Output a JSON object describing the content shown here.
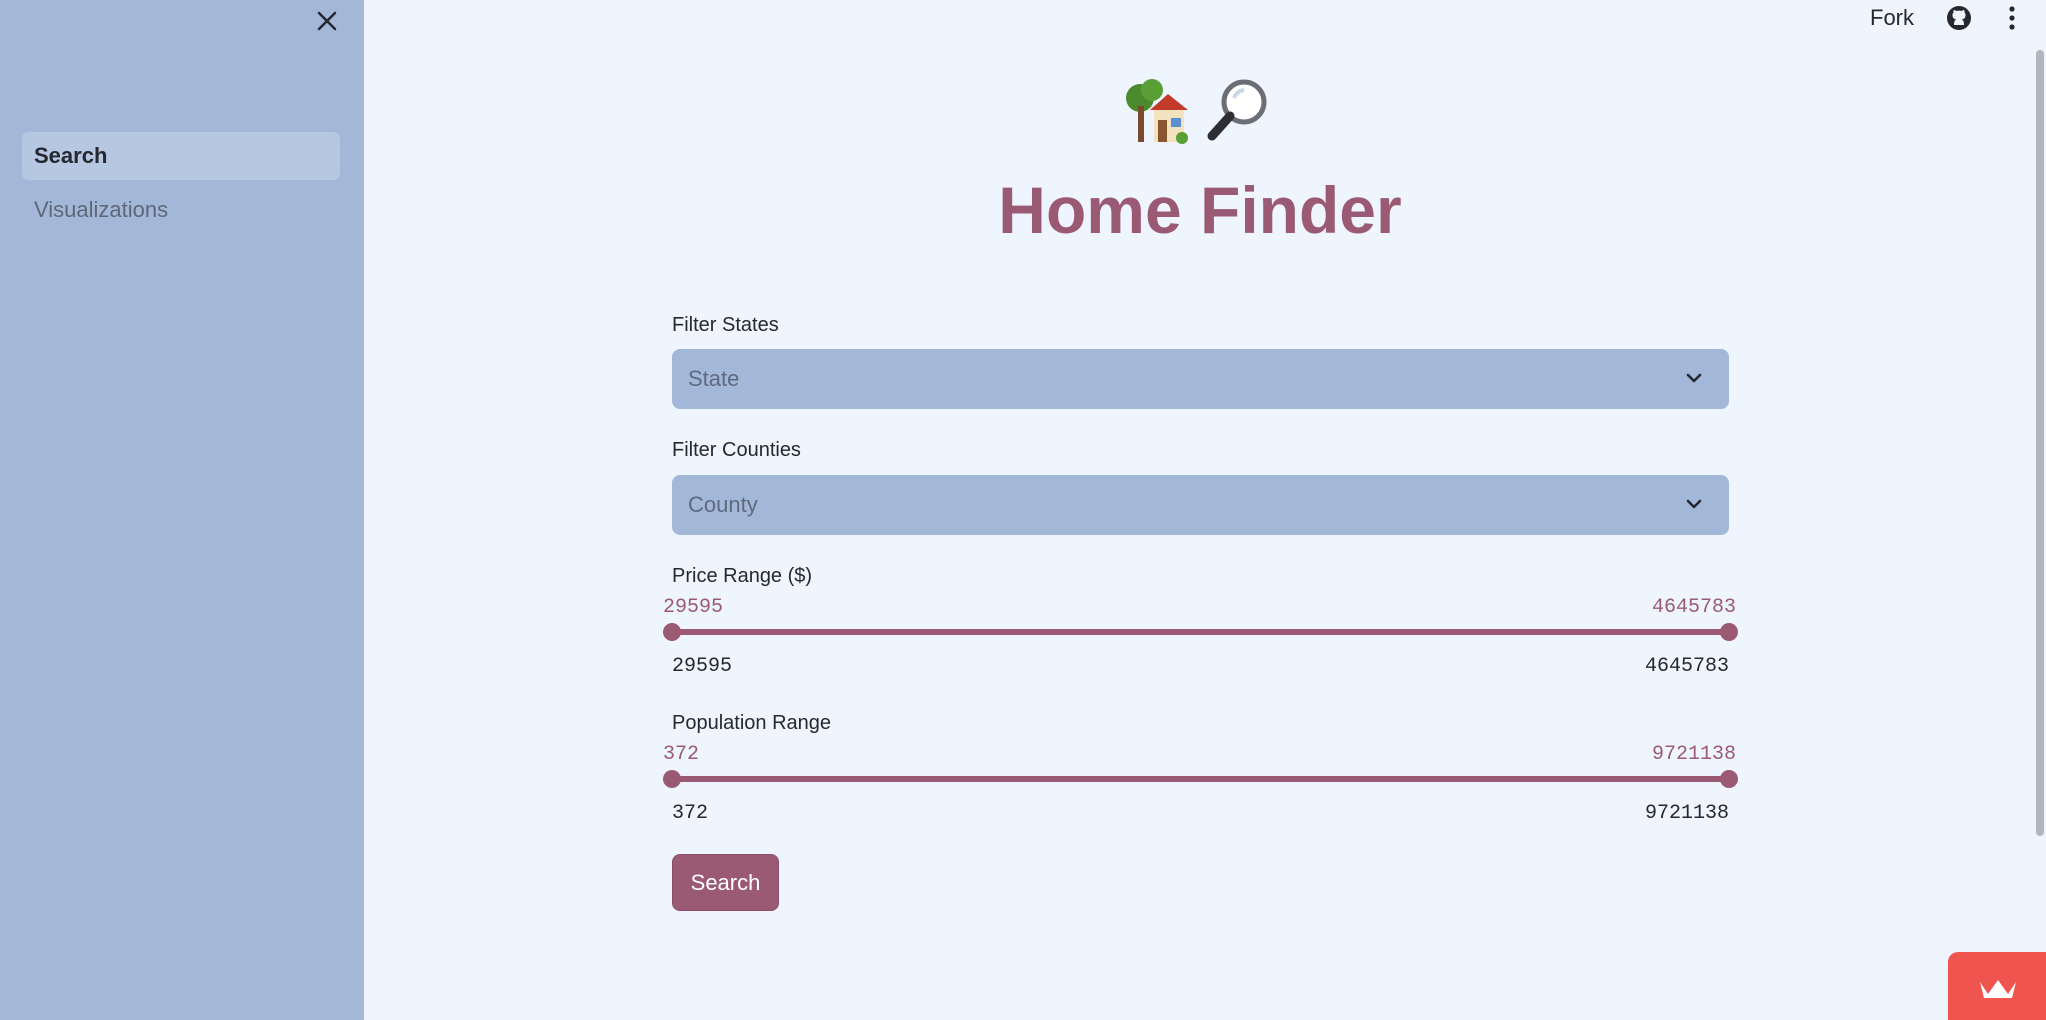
{
  "sidebar": {
    "items": [
      {
        "label": "Search",
        "active": true
      },
      {
        "label": "Visualizations",
        "active": false
      }
    ],
    "close_icon": "close-icon",
    "background": "#a3b8d8"
  },
  "toolbar": {
    "fork_label": "Fork",
    "github_icon": "github-icon",
    "menu_icon": "kebab-menu-icon"
  },
  "header": {
    "icons": [
      "house-with-garden-emoji",
      "magnifying-glass-emoji"
    ],
    "title": "Home Finder",
    "title_color": "#9a5a73"
  },
  "filters": {
    "states": {
      "label": "Filter States",
      "placeholder": "State"
    },
    "counties": {
      "label": "Filter Counties",
      "placeholder": "County"
    }
  },
  "price_range": {
    "label": "Price Range ($)",
    "selected_low": "29595",
    "selected_high": "4645783",
    "min": "29595",
    "max": "4645783"
  },
  "population_range": {
    "label": "Population Range",
    "selected_low": "372",
    "selected_high": "9721138",
    "min": "372",
    "max": "9721138"
  },
  "actions": {
    "search_label": "Search"
  },
  "colors": {
    "accent": "#9a5a73",
    "page_background": "#eff5fe",
    "select_background": "#a3b8d8",
    "badge": "#f0544f"
  }
}
